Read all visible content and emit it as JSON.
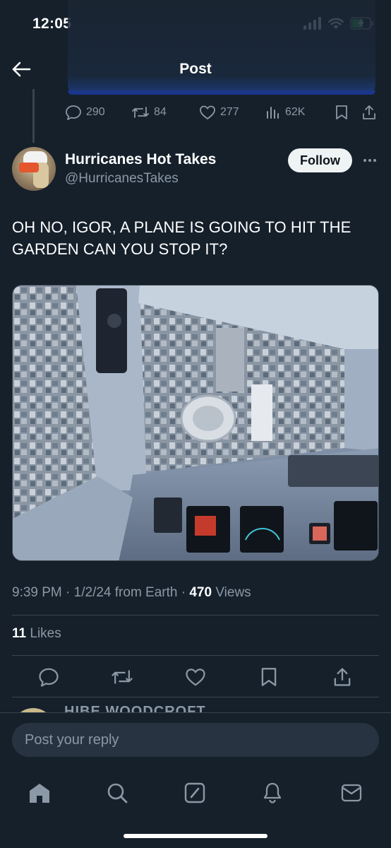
{
  "status_bar": {
    "time": "12:05"
  },
  "nav": {
    "title": "Post"
  },
  "previous_post": {
    "replies": "290",
    "reposts": "84",
    "likes": "277",
    "views": "62K"
  },
  "author": {
    "display_name": "Hurricanes Hot Takes",
    "handle": "@HurricanesTakes",
    "follow_label": "Follow"
  },
  "tweet": {
    "text": "OH NO, IGOR, A PLANE IS GOING TO HIT THE GARDEN CAN YOU STOP IT?",
    "time": "9:39 PM",
    "date": "1/2/24",
    "source": "from Earth",
    "views_count": "470",
    "views_label": "Views",
    "likes_count": "11",
    "likes_label": "Likes"
  },
  "reply_peek": {
    "name": "HIBE WOODCROFT"
  },
  "reply_bar": {
    "placeholder": "Post your reply"
  },
  "colors": {
    "background": "#15202b",
    "text": "#ffffff",
    "muted": "#8b98a5",
    "divider": "#38444d",
    "accent": "#1d9bf0"
  },
  "icons": {
    "status": [
      "signal-icon",
      "wifi-icon",
      "battery-charging-icon"
    ],
    "tabbar": [
      "home-icon",
      "search-icon",
      "grok-icon",
      "notifications-icon",
      "messages-icon"
    ],
    "actions": [
      "reply-icon",
      "repost-icon",
      "like-icon",
      "bookmark-icon",
      "share-icon"
    ]
  }
}
